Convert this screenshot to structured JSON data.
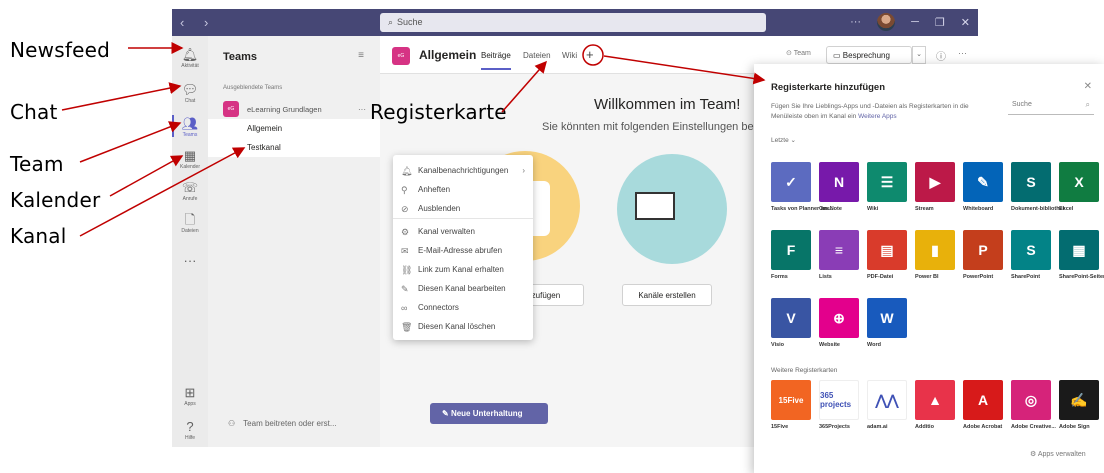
{
  "annotations": {
    "newsfeed": "Newsfeed",
    "chat": "Chat",
    "team": "Team",
    "kalender": "Kalender",
    "kanal": "Kanal",
    "registerkarte": "Registerkarte"
  },
  "titlebar": {
    "search_placeholder": "Suche",
    "nav": "‹ ›",
    "more": "···"
  },
  "rail": [
    {
      "icon": "bell-icon",
      "label": "Aktivität"
    },
    {
      "icon": "chat-icon",
      "label": "Chat"
    },
    {
      "icon": "teams-icon",
      "label": "Teams"
    },
    {
      "icon": "calendar-icon",
      "label": "Kalender"
    },
    {
      "icon": "phone-icon",
      "label": "Anrufe"
    },
    {
      "icon": "file-icon",
      "label": "Dateien"
    },
    {
      "icon": "apps-icon",
      "label": "Apps"
    },
    {
      "icon": "help-icon",
      "label": "Hilfe"
    }
  ],
  "teams_panel": {
    "title": "Teams",
    "hidden_label": "Ausgeblendete Teams",
    "team_name": "eLearning Grundlagen",
    "team_badge": "eG",
    "channels": [
      "Allgemein",
      "Testkanal"
    ],
    "join": "Team beitreten oder erst..."
  },
  "main": {
    "badge": "eG",
    "channel_title": "Allgemein",
    "tabs": [
      "Beiträge",
      "Dateien",
      "Wiki"
    ],
    "team_button": "Team",
    "meeting_button": "Besprechung",
    "welcome": "Willkommen im Team!",
    "welcome_sub": "Sie könnten mit folgenden Einstellungen be",
    "btn_add": "hinzufügen",
    "btn_create": "Kanäle erstellen",
    "btn_new": "Neue Unterhaltung"
  },
  "context_menu": [
    {
      "icon": "bell-icon",
      "label": "Kanalbenachrichtigungen"
    },
    {
      "icon": "pin-icon",
      "label": "Anheften"
    },
    {
      "icon": "hide-icon",
      "label": "Ausblenden"
    },
    {
      "icon": "gear-icon",
      "label": "Kanal verwalten"
    },
    {
      "icon": "mail-icon",
      "label": "E-Mail-Adresse abrufen"
    },
    {
      "icon": "link-icon",
      "label": "Link zum Kanal erhalten"
    },
    {
      "icon": "edit-icon",
      "label": "Diesen Kanal bearbeiten"
    },
    {
      "icon": "connector-icon",
      "label": "Connectors"
    },
    {
      "icon": "trash-icon",
      "label": "Diesen Kanal löschen"
    }
  ],
  "tab_panel": {
    "title": "Registerkarte hinzufügen",
    "description": "Fügen Sie Ihre Lieblings-Apps und -Dateien als Registerkarten in die Menüleiste oben im Kanal ein",
    "description_link": "Weitere Apps",
    "search_placeholder": "Suche",
    "recent_label": "Letzte",
    "more_label": "Weitere Registerkarten",
    "manage": "Apps verwalten",
    "recent_apps": [
      {
        "name": "Tasks von Planner un...",
        "color": "#5c6bc0",
        "glyph": "✓"
      },
      {
        "name": "OneNote",
        "color": "#7719aa",
        "glyph": "N"
      },
      {
        "name": "Wiki",
        "color": "#0e8a6e",
        "glyph": "☰"
      },
      {
        "name": "Stream",
        "color": "#bc1948",
        "glyph": "▶"
      },
      {
        "name": "Whiteboard",
        "color": "#0364b8",
        "glyph": "✎"
      },
      {
        "name": "Dokument-bibliothek",
        "color": "#036c70",
        "glyph": "S"
      },
      {
        "name": "Excel",
        "color": "#107c41",
        "glyph": "X"
      },
      {
        "name": "Forms",
        "color": "#077568",
        "glyph": "F"
      },
      {
        "name": "Lists",
        "color": "#8a3db6",
        "glyph": "≡"
      },
      {
        "name": "PDF-Datei",
        "color": "#d93b2b",
        "glyph": "▤"
      },
      {
        "name": "Power BI",
        "color": "#e8b10b",
        "glyph": "▮"
      },
      {
        "name": "PowerPoint",
        "color": "#c43e1c",
        "glyph": "P"
      },
      {
        "name": "SharePoint",
        "color": "#038387",
        "glyph": "S"
      },
      {
        "name": "SharePoint-Seiten",
        "color": "#036c70",
        "glyph": "▦"
      },
      {
        "name": "Visio",
        "color": "#3955a3",
        "glyph": "V"
      },
      {
        "name": "Website",
        "color": "#e3008c",
        "glyph": "⊕"
      },
      {
        "name": "Word",
        "color": "#185abd",
        "glyph": "W"
      }
    ],
    "more_apps": [
      {
        "name": "15Five",
        "color": "#f26522",
        "glyph": "15Five"
      },
      {
        "name": "365Projects",
        "color": "#ffffff",
        "glyph": "365 projects"
      },
      {
        "name": "adam.ai",
        "color": "#ffffff",
        "glyph": "⋀⋀"
      },
      {
        "name": "Additio",
        "color": "#e8334a",
        "glyph": "▲"
      },
      {
        "name": "Adobe Acrobat",
        "color": "#d71a1a",
        "glyph": "A"
      },
      {
        "name": "Adobe Creative...",
        "color": "#d6237a",
        "glyph": "◎"
      },
      {
        "name": "Adobe Sign",
        "color": "#1a1a1a",
        "glyph": "✍"
      }
    ]
  }
}
